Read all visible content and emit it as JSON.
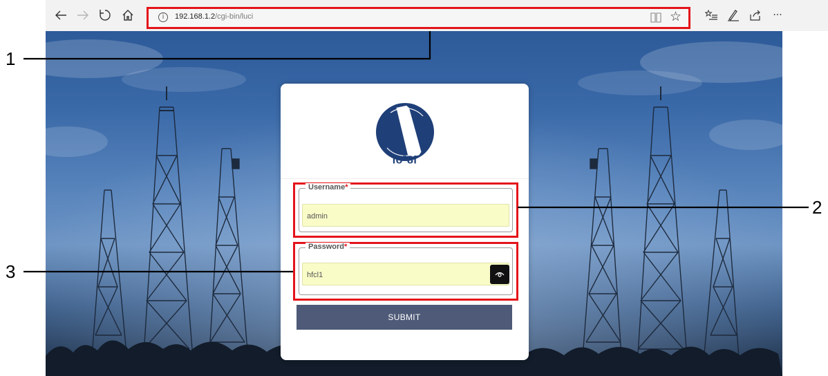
{
  "browser": {
    "back_icon": "arrow-left-icon",
    "forward_icon": "arrow-right-icon",
    "refresh_icon": "refresh-icon",
    "home_icon": "home-icon",
    "url_host": "192.168.1.2",
    "url_path": "/cgi-bin/luci",
    "favorites_icon": "star-icon",
    "menu_ellipsis": "···"
  },
  "login": {
    "brand": "io",
    "brand_sup": "n",
    "brand_suffix": "8l",
    "username_label": "Username",
    "username_value": "admin",
    "password_label": "Password",
    "password_value": "hfcl1",
    "required_mark": "*",
    "submit_label": "SUBMIT"
  },
  "callouts": [
    "1",
    "2",
    "3"
  ],
  "colors": {
    "highlight": "#e4131a",
    "submit": "#4e5a77",
    "input_autofill": "#fafcc8",
    "brand": "#1f3f78"
  }
}
